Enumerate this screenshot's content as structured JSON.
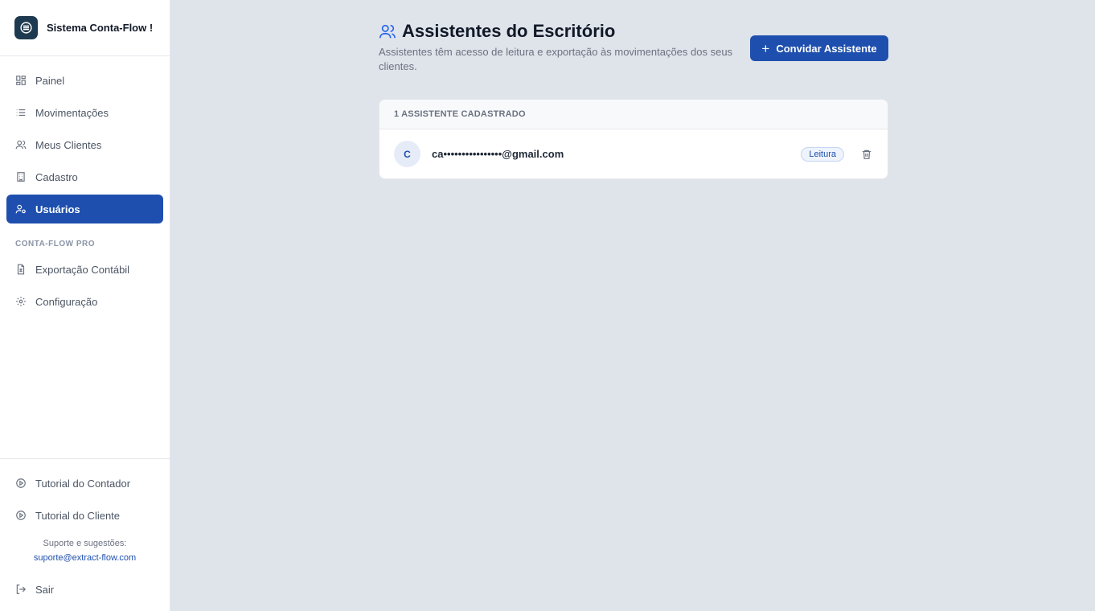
{
  "app": {
    "name": "Sistema Conta-Flow !"
  },
  "sidebar": {
    "items": [
      {
        "label": "Painel",
        "icon": "dashboard-icon"
      },
      {
        "label": "Movimentações",
        "icon": "list-icon"
      },
      {
        "label": "Meus Clientes",
        "icon": "users-icon"
      },
      {
        "label": "Cadastro",
        "icon": "building-icon"
      },
      {
        "label": "Usuários",
        "icon": "user-cog-icon",
        "active": true
      }
    ],
    "section_label": "CONTA-FLOW PRO",
    "pro_items": [
      {
        "label": "Exportação Contábil",
        "icon": "file-spreadsheet-icon"
      },
      {
        "label": "Configuração",
        "icon": "gear-icon"
      }
    ],
    "bottom": {
      "tutorial_contador": "Tutorial do Contador",
      "tutorial_cliente": "Tutorial do Cliente",
      "support_label": "Suporte e sugestões:",
      "support_email": "suporte@extract-flow.com",
      "logout": "Sair"
    }
  },
  "main": {
    "title": "Assistentes do Escritório",
    "subtitle": "Assistentes têm acesso de leitura e exportação às movimentações dos seus clientes.",
    "invite_button": "Convidar Assistente",
    "card": {
      "header": "1 ASSISTENTE CADASTRADO",
      "rows": [
        {
          "initial": "C",
          "email": "ca••••••••••••••••@gmail.com",
          "role": "Leitura"
        }
      ]
    }
  },
  "colors": {
    "accent": "#1e4fae",
    "background": "#dfe3ea"
  }
}
